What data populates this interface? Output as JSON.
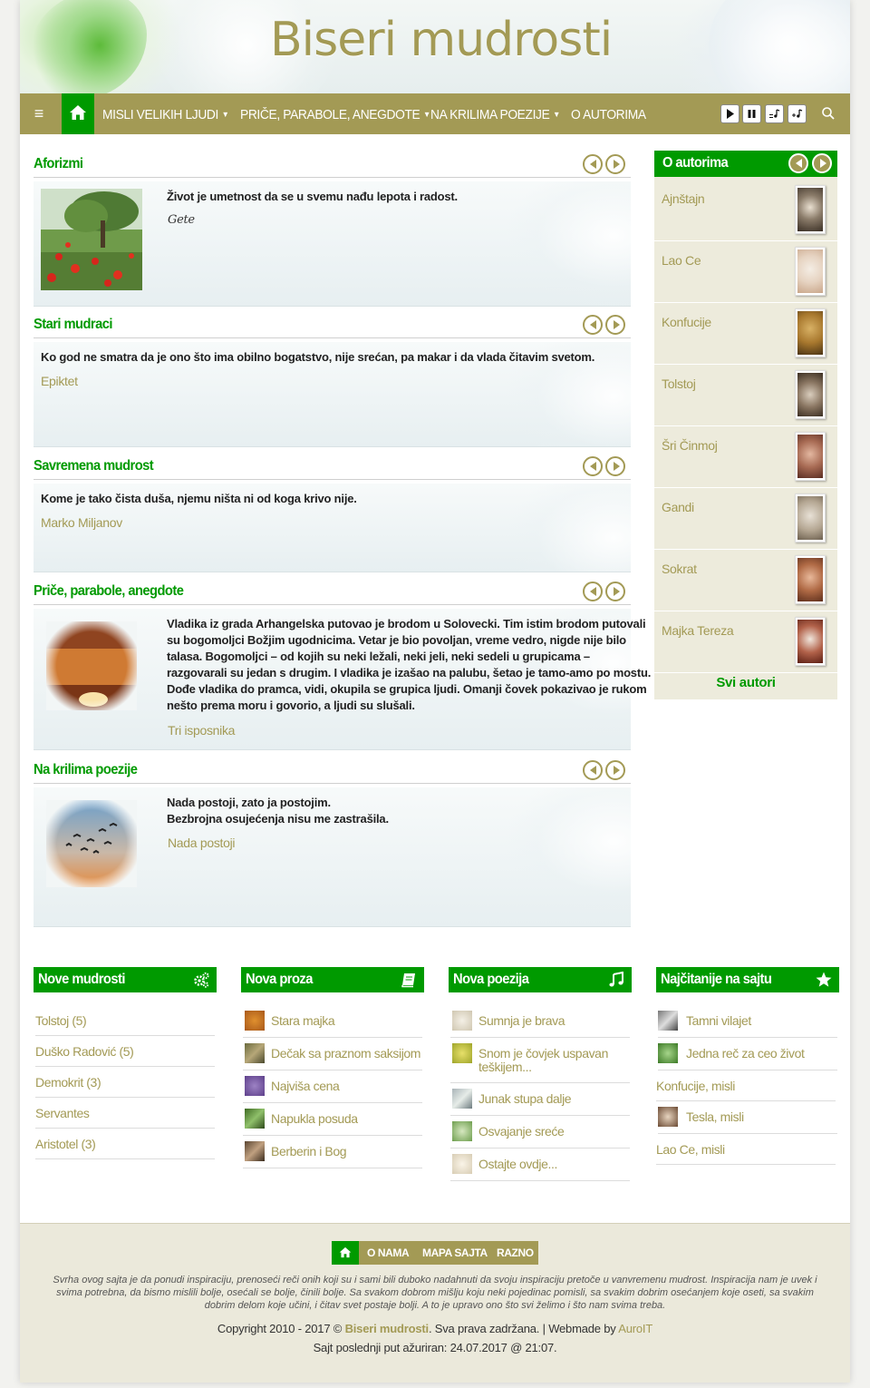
{
  "site": {
    "title": "Biseri mudrosti"
  },
  "nav": {
    "items": [
      {
        "label": "MISLI VELIKIH LJUDI",
        "has_caret": true
      },
      {
        "label": "PRIČE, PARABOLE, ANEGDOTE",
        "has_caret": true
      },
      {
        "label": "NA KRILIMA POEZIJE",
        "has_caret": true
      },
      {
        "label": "O AUTORIMA",
        "has_caret": false
      }
    ],
    "icons": [
      "menu-icon",
      "home-icon",
      "play-icon",
      "pause-icon",
      "playlist-icon",
      "shuffle-icon",
      "search-icon"
    ],
    "caret": "▼"
  },
  "sections": [
    {
      "title": "Aforizmi",
      "text": "Život je umetnost da se u svemu nađu lepota i radost.",
      "author": "Gete",
      "thumb": "poppy-field"
    },
    {
      "title": "Stari mudraci",
      "text": "Ko god ne smatra da je ono što ima obilno bogatstvo, nije srećan, pa makar i da vlada čitavim svetom.",
      "author": "Epiktet"
    },
    {
      "title": "Savremena mudrost",
      "text": "Kome je tako čista duša, njemu ništa ni od koga krivo nije.",
      "author": "Marko Miljanov"
    },
    {
      "title": "Priče, parabole, anegdote",
      "text_lines": [
        "Vladika iz grada Arhangelska putovao je brodom u Solovecki. Tim istim brodom putovali",
        "su bogomoljci Božjim ugodnicima. Vetar je bio povoljan, vreme vedro, nigde nije bilo",
        "talasa. Bogomoljci – od kojih su neki ležali, neki jeli, neki sedeli u grupicama –",
        "razgovarali su jedan s drugim. I vladika je izašao na palubu, šetao je tamo-amo po mostu.",
        "Dođe vladika do pramca, vidi, okupila se grupica ljudi. Omanji čovek pokazivao je rukom",
        "nešto prema moru i govorio, a ljudi su slušali."
      ],
      "author": "Tri isposnika",
      "thumb": "sunset-field"
    },
    {
      "title": "Na krilima poezije",
      "text_lines": [
        "Nada postoji, zato ja postojim.",
        "Bezbrojna osujećenja nisu me zastrašila."
      ],
      "author": "Nada postoji",
      "thumb": "birds-sunset"
    }
  ],
  "sidebar": {
    "title": "O autorima",
    "authors": [
      "Ajnštajn",
      "Lao Ce",
      "Konfucije",
      "Tolstoj",
      "Šri Činmoj",
      "Gandi",
      "Sokrat",
      "Majka Tereza"
    ],
    "all_link": "Svi autori"
  },
  "widgets": [
    {
      "title": "Nove mudrosti",
      "icon": "gears-icon",
      "items": [
        "Tolstoj (5)",
        "Duško Radović (5)",
        "Demokrit (3)",
        "Servantes",
        "Aristotel (3)"
      ]
    },
    {
      "title": "Nova proza",
      "icon": "book-icon",
      "items": [
        "Stara majka",
        "Dečak sa praznom saksijom",
        "Najviša cena",
        "Napukla posuda",
        "Berberin i Bog"
      ]
    },
    {
      "title": "Nova poezija",
      "icon": "music-icon",
      "items": [
        "Sumnja je brava",
        "Snom je čovjek uspavan",
        "teškijem...",
        "Junak stupa dalje",
        "Osvajanje sreće",
        "Ostajte ovdje..."
      ]
    },
    {
      "title": "Najčitanije na sajtu",
      "icon": "star-icon",
      "items": [
        "Tamni vilajet",
        "Jedna reč za ceo život",
        "Konfucije, misli",
        "Tesla, misli",
        "Lao Ce, misli"
      ]
    }
  ],
  "footer": {
    "links": [
      "O NAMA",
      "MAPA SAJTA",
      "RAZNO"
    ],
    "about_lines": [
      "Svrha ovog sajta je da ponudi inspiraciju, prenoseći reči onih koji su i sami bili duboko nadahnuti da svoju inspiraciju pretoče u vanvremenu mudrost. Inspiracija nam je uvek i",
      "svima potrebna, da bismo mislili bolje, osećali se bolje, činili bolje. Sa svakom dobrom mišlju koju neki pojedinac pomisli, sa svakim dobrim osećanjem koje oseti, sa svakim",
      "dobrim delom koje učini, i čitav svet postaje bolji. A to je upravo ono što svi želimo i što nam svima treba."
    ],
    "copy_prefix": "Copyright 2010 - 2017 © ",
    "copy_site": "Biseri mudrosti",
    "copy_mid": ". Sva prava zadržana. | Webmade by ",
    "copy_dev": "AuroIT",
    "updated": "Sajt poslednji put ažuriran: 24.07.2017 @ 21:07."
  },
  "colors": {
    "accent": "#009a00",
    "olive": "#a39a55",
    "sidebar_bg": "#edebdc",
    "footer_bg": "#ebe9db"
  }
}
